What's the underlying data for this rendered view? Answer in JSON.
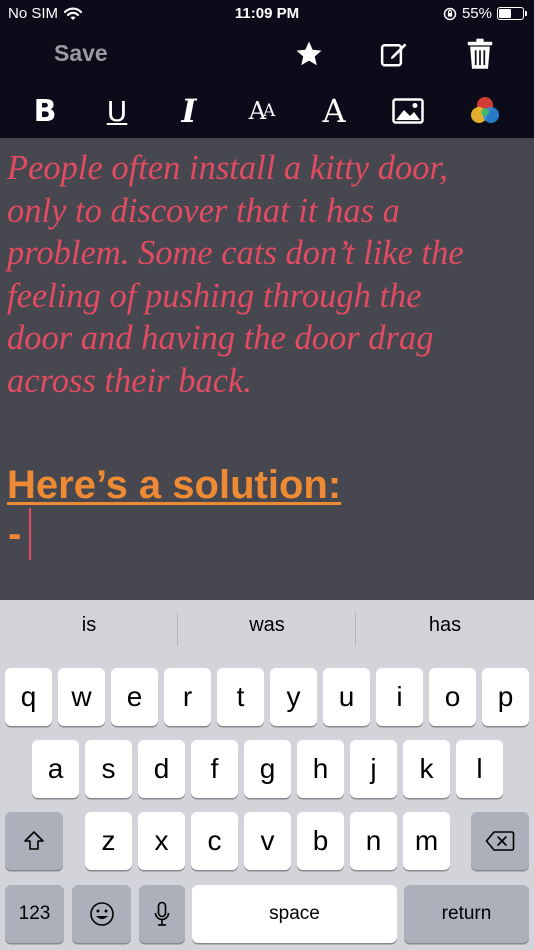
{
  "status_bar": {
    "carrier": "No SIM",
    "time": "11:09 PM",
    "battery_percent_label": "55%",
    "battery_level": 0.55,
    "icons": [
      "wifi-icon",
      "orientation-lock-icon",
      "battery-icon"
    ]
  },
  "toolbar": {
    "save_label": "Save",
    "icons": [
      "star-icon",
      "edit-icon",
      "trash-icon"
    ]
  },
  "format_bar": {
    "bold_label": "B",
    "underline_label": "U",
    "italic_label": "I",
    "size_label_big": "A",
    "size_label_small": "A",
    "font_label": "A",
    "icons": [
      "image-icon",
      "color-wheel-icon"
    ]
  },
  "editor": {
    "body_lines": [
      "People often install a kitty door,",
      "only to discover that it has a",
      "problem. Some cats don’t like the",
      "feeling of pushing through the",
      "door and having the door drag",
      "across their back."
    ],
    "heading": "Here’s a solution:",
    "current_line": "-",
    "colors": {
      "background": "#47474f",
      "body_text": "#e24b62",
      "heading": "#ef8a34"
    }
  },
  "keyboard": {
    "suggestions": [
      "is",
      "was",
      "has"
    ],
    "row1": [
      "q",
      "w",
      "e",
      "r",
      "t",
      "y",
      "u",
      "i",
      "o",
      "p"
    ],
    "row2": [
      "a",
      "s",
      "d",
      "f",
      "g",
      "h",
      "j",
      "k",
      "l"
    ],
    "row3": [
      "z",
      "x",
      "c",
      "v",
      "b",
      "n",
      "m"
    ],
    "numbers_label": "123",
    "space_label": "space",
    "return_label": "return",
    "icons": [
      "shift-icon",
      "backspace-icon",
      "emoji-icon",
      "microphone-icon"
    ]
  }
}
